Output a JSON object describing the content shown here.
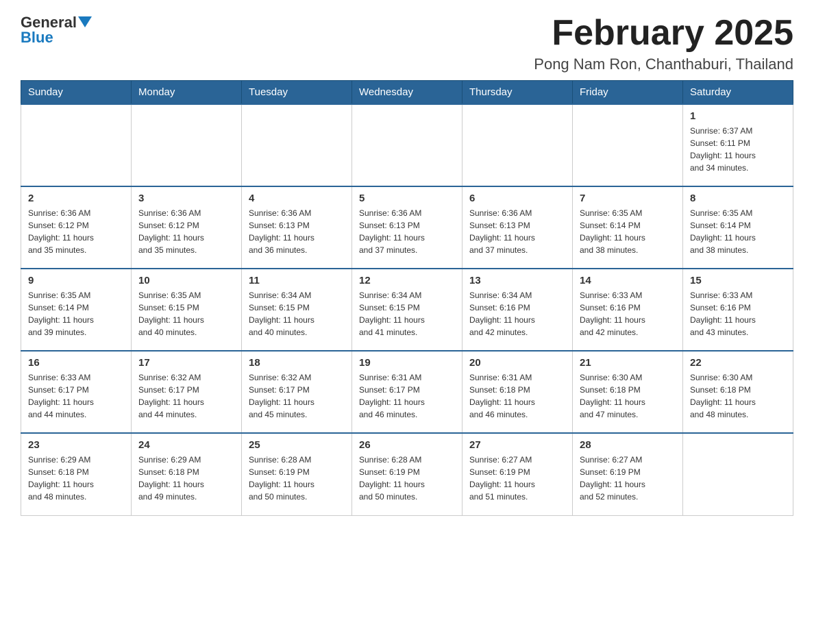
{
  "header": {
    "logo_general": "General",
    "logo_blue": "Blue",
    "month_title": "February 2025",
    "location": "Pong Nam Ron, Chanthaburi, Thailand"
  },
  "weekdays": [
    "Sunday",
    "Monday",
    "Tuesday",
    "Wednesday",
    "Thursday",
    "Friday",
    "Saturday"
  ],
  "weeks": [
    [
      {
        "day": "",
        "info": ""
      },
      {
        "day": "",
        "info": ""
      },
      {
        "day": "",
        "info": ""
      },
      {
        "day": "",
        "info": ""
      },
      {
        "day": "",
        "info": ""
      },
      {
        "day": "",
        "info": ""
      },
      {
        "day": "1",
        "info": "Sunrise: 6:37 AM\nSunset: 6:11 PM\nDaylight: 11 hours\nand 34 minutes."
      }
    ],
    [
      {
        "day": "2",
        "info": "Sunrise: 6:36 AM\nSunset: 6:12 PM\nDaylight: 11 hours\nand 35 minutes."
      },
      {
        "day": "3",
        "info": "Sunrise: 6:36 AM\nSunset: 6:12 PM\nDaylight: 11 hours\nand 35 minutes."
      },
      {
        "day": "4",
        "info": "Sunrise: 6:36 AM\nSunset: 6:13 PM\nDaylight: 11 hours\nand 36 minutes."
      },
      {
        "day": "5",
        "info": "Sunrise: 6:36 AM\nSunset: 6:13 PM\nDaylight: 11 hours\nand 37 minutes."
      },
      {
        "day": "6",
        "info": "Sunrise: 6:36 AM\nSunset: 6:13 PM\nDaylight: 11 hours\nand 37 minutes."
      },
      {
        "day": "7",
        "info": "Sunrise: 6:35 AM\nSunset: 6:14 PM\nDaylight: 11 hours\nand 38 minutes."
      },
      {
        "day": "8",
        "info": "Sunrise: 6:35 AM\nSunset: 6:14 PM\nDaylight: 11 hours\nand 38 minutes."
      }
    ],
    [
      {
        "day": "9",
        "info": "Sunrise: 6:35 AM\nSunset: 6:14 PM\nDaylight: 11 hours\nand 39 minutes."
      },
      {
        "day": "10",
        "info": "Sunrise: 6:35 AM\nSunset: 6:15 PM\nDaylight: 11 hours\nand 40 minutes."
      },
      {
        "day": "11",
        "info": "Sunrise: 6:34 AM\nSunset: 6:15 PM\nDaylight: 11 hours\nand 40 minutes."
      },
      {
        "day": "12",
        "info": "Sunrise: 6:34 AM\nSunset: 6:15 PM\nDaylight: 11 hours\nand 41 minutes."
      },
      {
        "day": "13",
        "info": "Sunrise: 6:34 AM\nSunset: 6:16 PM\nDaylight: 11 hours\nand 42 minutes."
      },
      {
        "day": "14",
        "info": "Sunrise: 6:33 AM\nSunset: 6:16 PM\nDaylight: 11 hours\nand 42 minutes."
      },
      {
        "day": "15",
        "info": "Sunrise: 6:33 AM\nSunset: 6:16 PM\nDaylight: 11 hours\nand 43 minutes."
      }
    ],
    [
      {
        "day": "16",
        "info": "Sunrise: 6:33 AM\nSunset: 6:17 PM\nDaylight: 11 hours\nand 44 minutes."
      },
      {
        "day": "17",
        "info": "Sunrise: 6:32 AM\nSunset: 6:17 PM\nDaylight: 11 hours\nand 44 minutes."
      },
      {
        "day": "18",
        "info": "Sunrise: 6:32 AM\nSunset: 6:17 PM\nDaylight: 11 hours\nand 45 minutes."
      },
      {
        "day": "19",
        "info": "Sunrise: 6:31 AM\nSunset: 6:17 PM\nDaylight: 11 hours\nand 46 minutes."
      },
      {
        "day": "20",
        "info": "Sunrise: 6:31 AM\nSunset: 6:18 PM\nDaylight: 11 hours\nand 46 minutes."
      },
      {
        "day": "21",
        "info": "Sunrise: 6:30 AM\nSunset: 6:18 PM\nDaylight: 11 hours\nand 47 minutes."
      },
      {
        "day": "22",
        "info": "Sunrise: 6:30 AM\nSunset: 6:18 PM\nDaylight: 11 hours\nand 48 minutes."
      }
    ],
    [
      {
        "day": "23",
        "info": "Sunrise: 6:29 AM\nSunset: 6:18 PM\nDaylight: 11 hours\nand 48 minutes."
      },
      {
        "day": "24",
        "info": "Sunrise: 6:29 AM\nSunset: 6:18 PM\nDaylight: 11 hours\nand 49 minutes."
      },
      {
        "day": "25",
        "info": "Sunrise: 6:28 AM\nSunset: 6:19 PM\nDaylight: 11 hours\nand 50 minutes."
      },
      {
        "day": "26",
        "info": "Sunrise: 6:28 AM\nSunset: 6:19 PM\nDaylight: 11 hours\nand 50 minutes."
      },
      {
        "day": "27",
        "info": "Sunrise: 6:27 AM\nSunset: 6:19 PM\nDaylight: 11 hours\nand 51 minutes."
      },
      {
        "day": "28",
        "info": "Sunrise: 6:27 AM\nSunset: 6:19 PM\nDaylight: 11 hours\nand 52 minutes."
      },
      {
        "day": "",
        "info": ""
      }
    ]
  ]
}
